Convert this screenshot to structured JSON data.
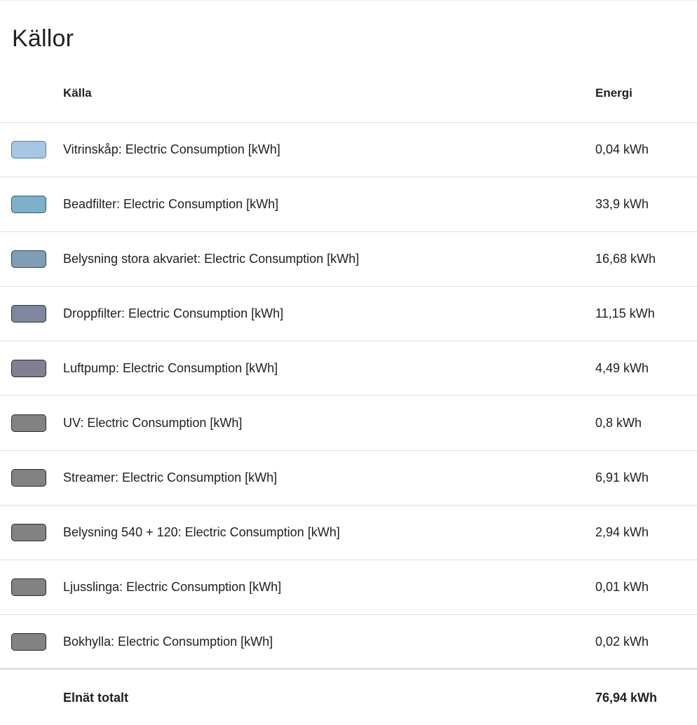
{
  "card": {
    "title": "Källor"
  },
  "table": {
    "headers": {
      "source": "Källa",
      "energy": "Energi"
    },
    "rows": [
      {
        "name": "Vitrinskåp: Electric Consumption [kWh]",
        "energy": "0,04 kWh",
        "color": "#a6c7e4",
        "border": "#4d7ea8"
      },
      {
        "name": "Beadfilter: Electric Consumption [kWh]",
        "energy": "33,9 kWh",
        "color": "#7fb0c9",
        "border": "#2f5d75"
      },
      {
        "name": "Belysning stora akvariet: Electric Consumption [kWh]",
        "energy": "16,68 kWh",
        "color": "#7f9db4",
        "border": "#2d4b62"
      },
      {
        "name": "Droppfilter: Electric Consumption [kWh]",
        "energy": "11,15 kWh",
        "color": "#7f879e",
        "border": "#2a3246"
      },
      {
        "name": "Luftpump: Electric Consumption [kWh]",
        "energy": "4,49 kWh",
        "color": "#818090",
        "border": "#2b2a36"
      },
      {
        "name": "UV: Electric Consumption [kWh]",
        "energy": "0,8 kWh",
        "color": "#828282",
        "border": "#2b2b2b"
      },
      {
        "name": "Streamer: Electric Consumption [kWh]",
        "energy": "6,91 kWh",
        "color": "#828282",
        "border": "#2b2b2b"
      },
      {
        "name": "Belysning 540 + 120: Electric Consumption [kWh]",
        "energy": "2,94 kWh",
        "color": "#828282",
        "border": "#2b2b2b"
      },
      {
        "name": "Ljusslinga: Electric Consumption [kWh]",
        "energy": "0,01 kWh",
        "color": "#828282",
        "border": "#2b2b2b"
      },
      {
        "name": "Bokhylla: Electric Consumption [kWh]",
        "energy": "0,02 kWh",
        "color": "#828282",
        "border": "#2b2b2b"
      }
    ],
    "footer": {
      "label": "Elnät totalt",
      "value": "76,94 kWh"
    }
  }
}
